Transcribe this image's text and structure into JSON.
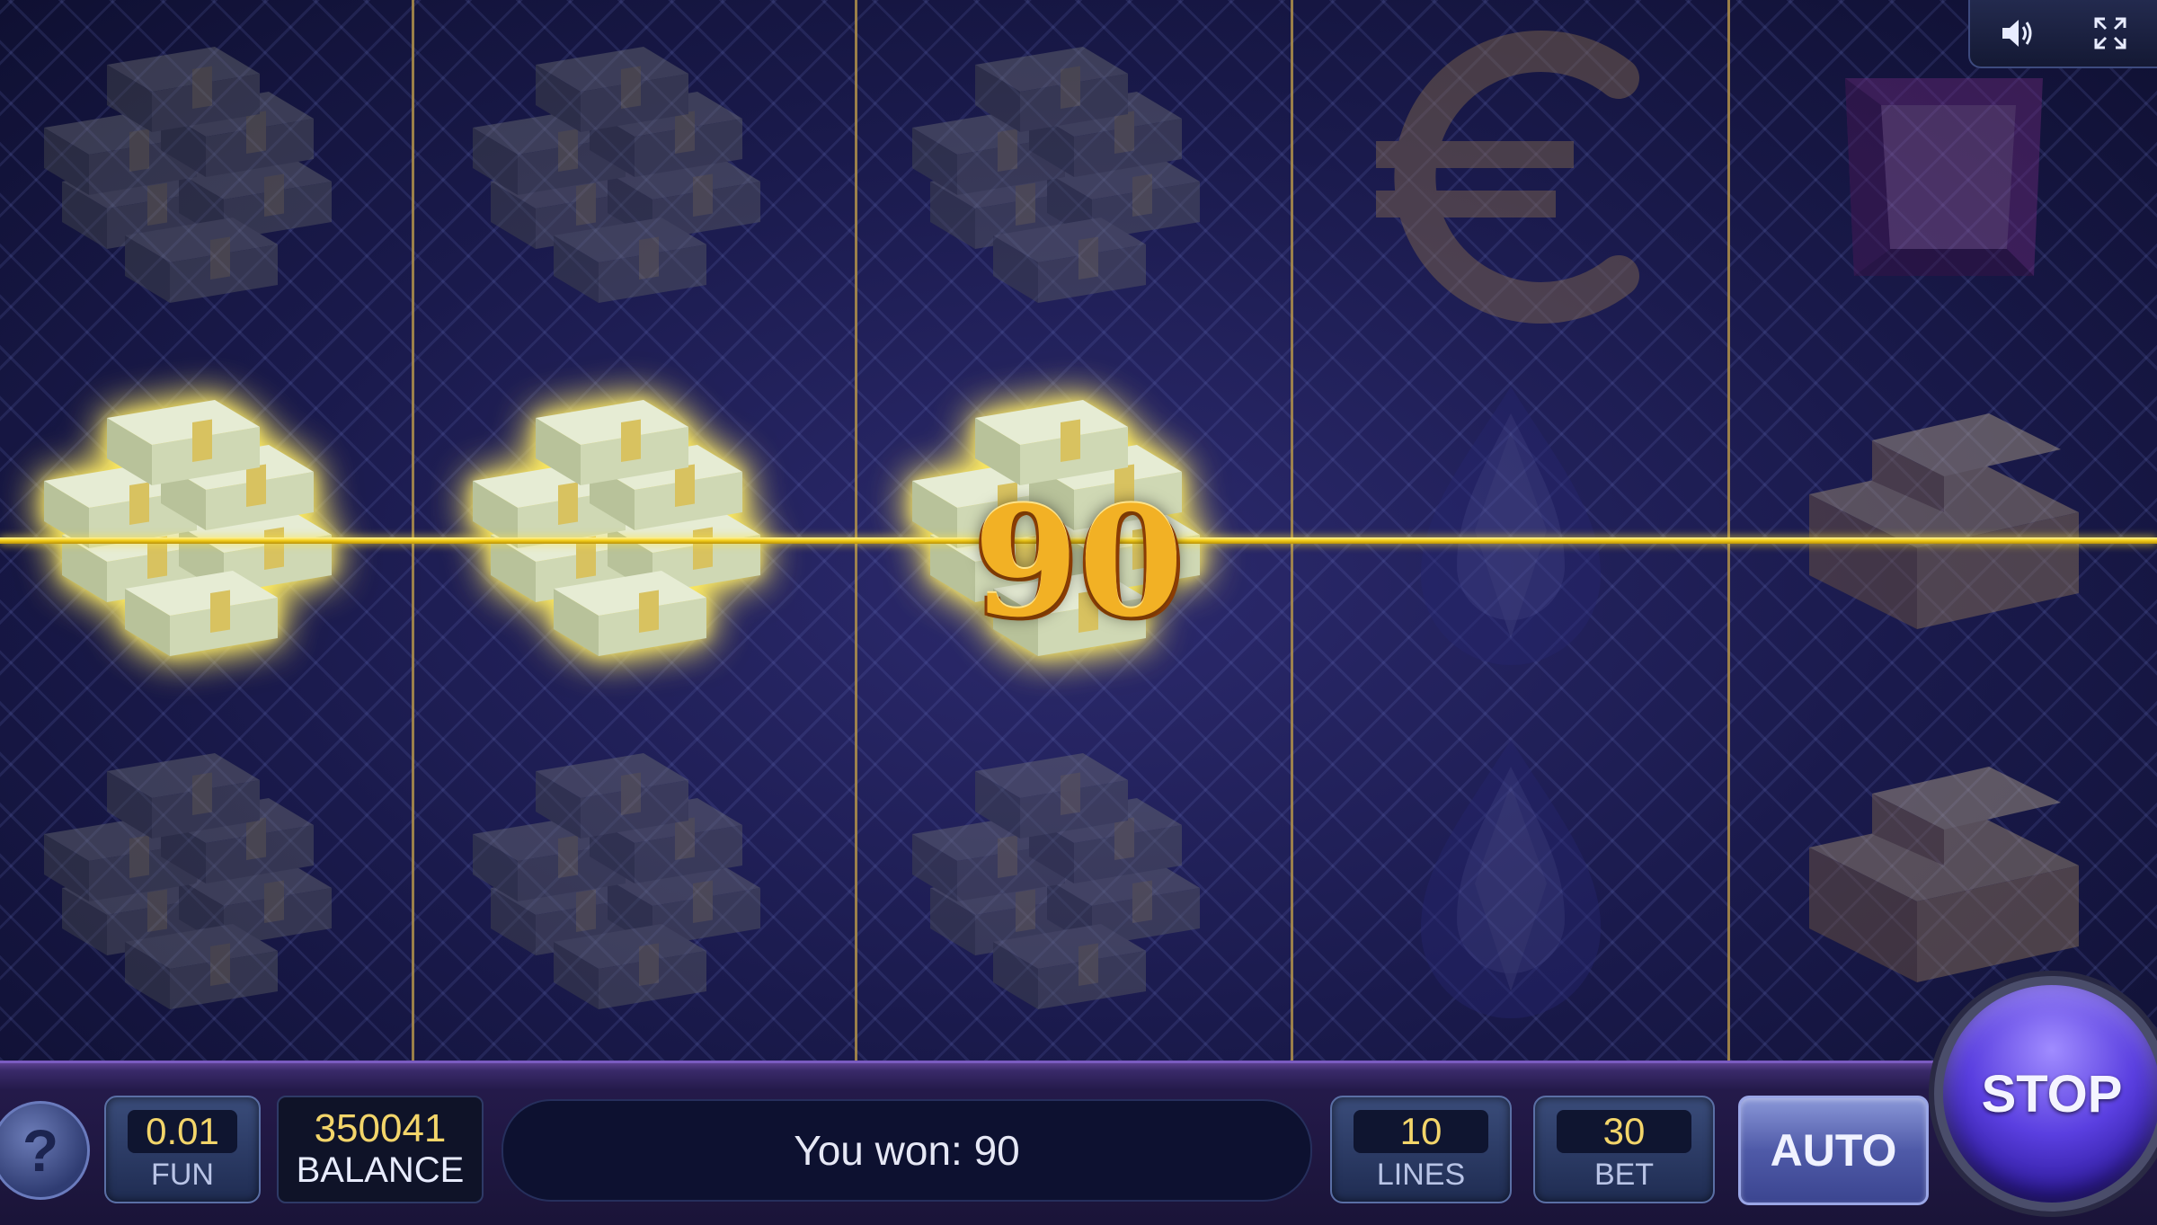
{
  "reels": [
    {
      "symbols": [
        "money-stack",
        "money-stack",
        "money-stack"
      ],
      "highlighted_row": 1
    },
    {
      "symbols": [
        "money-stack",
        "money-stack",
        "money-stack"
      ],
      "highlighted_row": 1
    },
    {
      "symbols": [
        "money-stack",
        "money-stack",
        "money-stack"
      ],
      "highlighted_row": 1
    },
    {
      "symbols": [
        "euro-sign",
        "blue-gem",
        "blue-gem"
      ],
      "highlighted_row": null
    },
    {
      "symbols": [
        "purple-gem",
        "gold-bars",
        "gold-bars"
      ],
      "highlighted_row": null
    }
  ],
  "win": {
    "amount_text": "90"
  },
  "top_controls": {
    "icons": [
      "speaker-icon",
      "fullscreen-icon"
    ]
  },
  "bottom_bar": {
    "help_label": "?",
    "coin": {
      "value": "0.01",
      "label": "FUN"
    },
    "balance": {
      "value": "350041",
      "label": "BALANCE"
    },
    "message": "You won: 90",
    "lines": {
      "value": "10",
      "label": "LINES"
    },
    "bet": {
      "value": "30",
      "label": "BET"
    },
    "auto_label": "AUTO",
    "stop_label": "STOP"
  },
  "colors": {
    "payline": "#f2cc17",
    "accent_gold": "#f2b125",
    "stop_button": "#5a3fe0"
  }
}
